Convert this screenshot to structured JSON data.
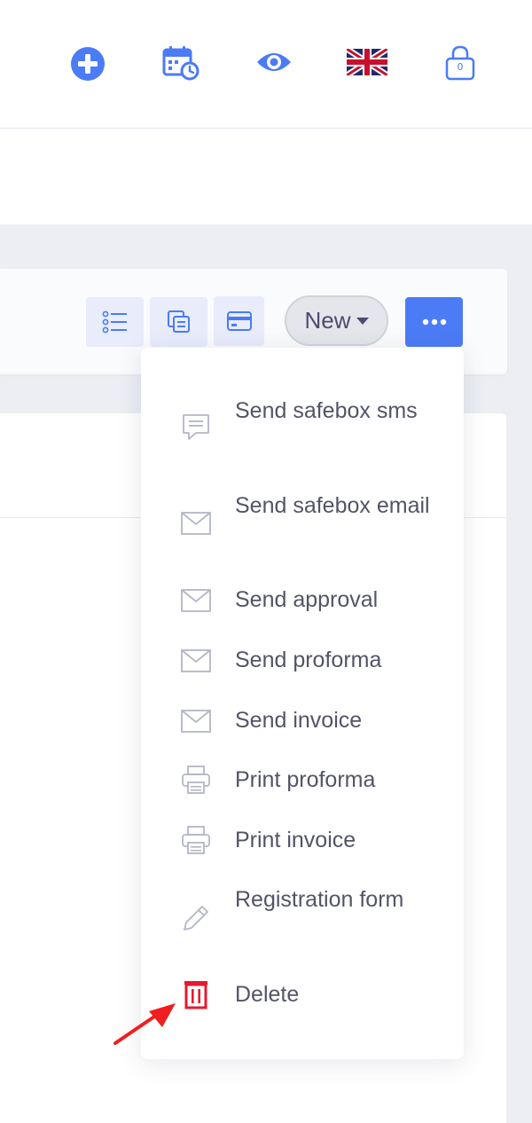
{
  "header": {
    "icons": [
      "plus-circle-icon",
      "calendar-clock-icon",
      "eye-icon",
      "uk-flag-icon",
      "lock-icon"
    ],
    "lock_badge": "0"
  },
  "toolbar": {
    "new_label": "New",
    "tool_icons": [
      "list-icon",
      "copy-icon",
      "card-icon"
    ],
    "more_icon": "ellipsis-icon"
  },
  "dropdown": {
    "items": [
      {
        "label": "Send safebox sms",
        "icon": "message-icon"
      },
      {
        "label": "Send safebox email",
        "icon": "envelope-icon"
      },
      {
        "label": "Send approval",
        "icon": "envelope-icon"
      },
      {
        "label": "Send proforma",
        "icon": "envelope-icon"
      },
      {
        "label": "Send invoice",
        "icon": "envelope-icon"
      },
      {
        "label": "Print proforma",
        "icon": "printer-icon"
      },
      {
        "label": "Print invoice",
        "icon": "printer-icon"
      },
      {
        "label": "Registration form",
        "icon": "pencil-icon"
      },
      {
        "label": "Delete",
        "icon": "trash-icon"
      }
    ]
  },
  "colors": {
    "accent": "#4b7bf5",
    "menu_text": "#535467",
    "menu_icon": "#b3b6c6",
    "danger": "#e8192c",
    "annotation_arrow": "#f01e1e"
  }
}
